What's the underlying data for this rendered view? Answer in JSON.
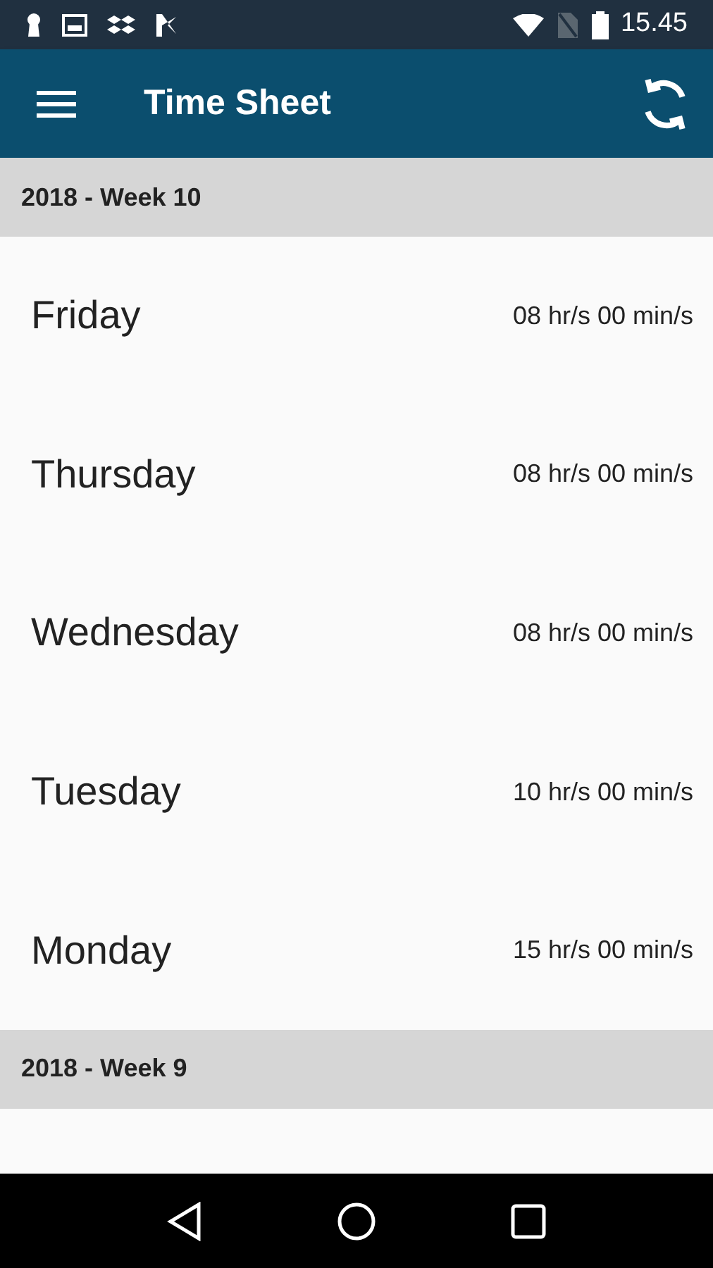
{
  "status_bar": {
    "time": "15.45"
  },
  "app_bar": {
    "title": "Time Sheet"
  },
  "weeks": [
    {
      "header": "2018 - Week 10",
      "days": [
        {
          "day": "Friday",
          "hours": "08 hr/s 00 min/s"
        },
        {
          "day": "Thursday",
          "hours": "08 hr/s 00 min/s"
        },
        {
          "day": "Wednesday",
          "hours": "08 hr/s 00 min/s"
        },
        {
          "day": "Tuesday",
          "hours": "10 hr/s 00 min/s"
        },
        {
          "day": "Monday",
          "hours": "15 hr/s 00 min/s"
        }
      ]
    },
    {
      "header": "2018 - Week 9"
    }
  ]
}
